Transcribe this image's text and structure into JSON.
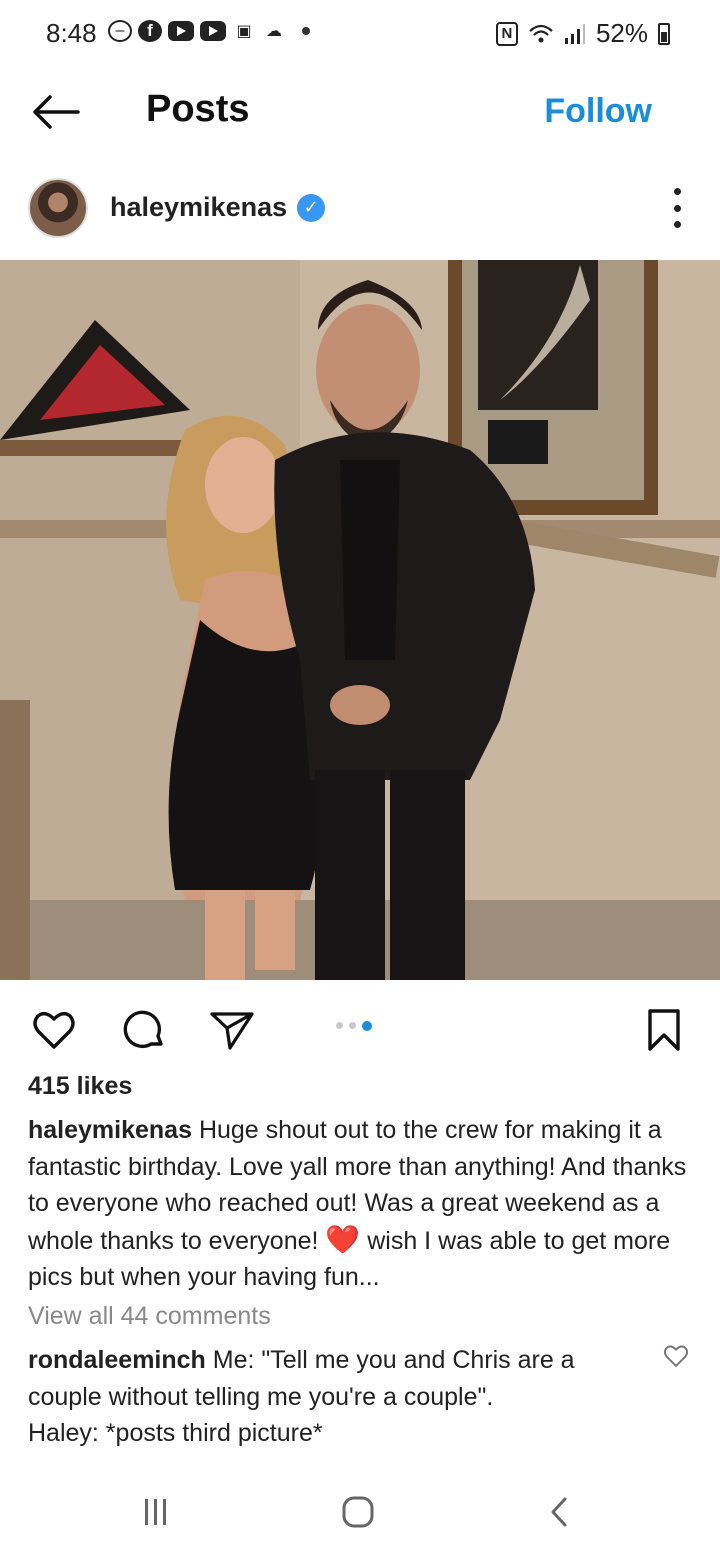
{
  "status_bar": {
    "time": "8:48",
    "battery": "52%",
    "icons": [
      "do-not-disturb-icon",
      "facebook-icon",
      "youtube-icon",
      "youtube-icon",
      "photo-icon",
      "cloud-icon",
      "dot-icon",
      "nfc-icon",
      "wifi-icon",
      "signal-icon",
      "battery-icon"
    ]
  },
  "header": {
    "title": "Posts",
    "follow_label": "Follow"
  },
  "post": {
    "username": "haleymikenas",
    "verified": true,
    "likes": "415 likes",
    "caption_username": "haleymikenas",
    "caption_text_1": " Huge shout out to the crew for making it a fantastic birthday. Love yall more than anything! And thanks to everyone who reached out! Was a great weekend as a whole thanks to everyone! ",
    "caption_emoji": "❤️",
    "caption_text_2": " wish I was able to get more pics but when your having fun...",
    "view_comments": "View all 44 comments",
    "carousel": {
      "count": 3,
      "active_index": 2
    }
  },
  "comment": {
    "username": "rondaleeminch",
    "text": " Me: \"Tell me you and Chris are a couple without telling me you're a couple\".\nHaley: *posts third picture*"
  },
  "colors": {
    "accent": "#1a8cd8",
    "verified": "#3897f0",
    "muted": "#888888"
  }
}
